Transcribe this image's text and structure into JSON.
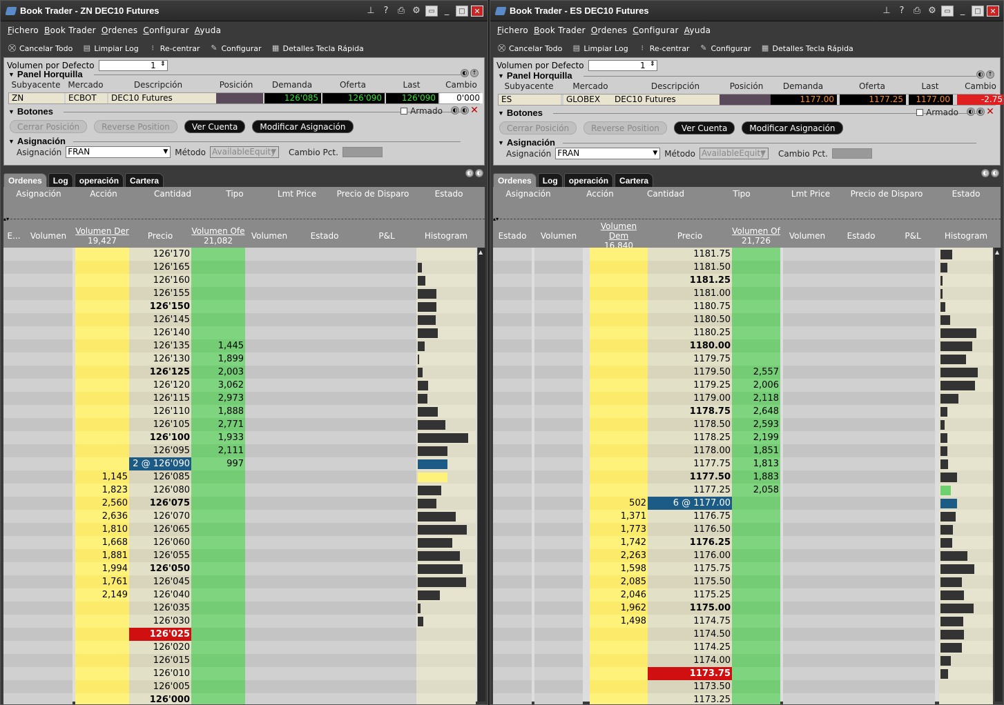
{
  "windows": [
    {
      "title": "Book Trader - ZN DEC10 Futures",
      "menu": [
        "Fichero",
        "Book Trader",
        "Ordenes",
        "Configurar",
        "Ayuda"
      ],
      "toolbar": [
        "Cancelar Todo",
        "Limpiar Log",
        "Re-centrar",
        "Configurar",
        "Detalles Tecla Rápida"
      ],
      "volumen_label": "Volumen por Defecto",
      "volumen_value": "1",
      "panel_title": "Panel Horquilla",
      "headers": [
        "Subyacente",
        "Mercado",
        "Descripción",
        "Posición",
        "Demanda",
        "Oferta",
        "Last",
        "Cambio"
      ],
      "quote": {
        "sub": "ZN",
        "mkt": "ECBOT",
        "desc": "DEC10 Futures",
        "pos": "",
        "bid": "126'085",
        "ask": "126'090",
        "last": "126'090",
        "chg": "0'000",
        "chg_color": "#000000"
      },
      "botones_title": "Botones",
      "armado": "Armado",
      "buttons": [
        "Cerrar Posición",
        "Reverse Position",
        "Ver Cuenta",
        "Modificar Asignación"
      ],
      "asig_title": "Asignación",
      "asig_label": "Asignación",
      "asig_value": "FRAN",
      "metodo_label": "Método",
      "metodo_value": "AvailableEquity",
      "cambio_pct": "Cambio Pct.",
      "tabs": [
        "Ordenes",
        "Log",
        "operación",
        "Cartera"
      ],
      "order_cols": [
        "Asignación",
        "Acción",
        "Cantidad",
        "Tipo",
        "Lmt Price",
        "Precio de Disparo",
        "Estado"
      ],
      "book_cols": {
        "estado": "E...",
        "vol1": "Volumen",
        "bidvol": "Volumen Der",
        "bidvol_total": "19,427",
        "price": "Precio",
        "askvol": "Volumen Ofe",
        "askvol_total": "21,082",
        "vol2": "Volumen",
        "estado2": "Estado",
        "pnl": "P&L",
        "hist": "Histogram"
      },
      "rows": [
        {
          "p": "126'170",
          "b": "",
          "a": "",
          "h": 0,
          "bold": false
        },
        {
          "p": "126'165",
          "b": "",
          "a": "",
          "h": 0.08
        },
        {
          "p": "126'160",
          "b": "",
          "a": "",
          "h": 0.14
        },
        {
          "p": "126'155",
          "b": "",
          "a": "",
          "h": 0.36
        },
        {
          "p": "126'150",
          "b": "",
          "a": "",
          "h": 0.36,
          "bold": true
        },
        {
          "p": "126'145",
          "b": "",
          "a": "",
          "h": 0.34
        },
        {
          "p": "126'140",
          "b": "",
          "a": "",
          "h": 0.38
        },
        {
          "p": "126'135",
          "b": "",
          "a": "1,445",
          "h": 0.13
        },
        {
          "p": "126'130",
          "b": "",
          "a": "1,899",
          "h": 0.03
        },
        {
          "p": "126'125",
          "b": "",
          "a": "2,003",
          "h": 0.09,
          "bold": true
        },
        {
          "p": "126'120",
          "b": "",
          "a": "3,062",
          "h": 0.2
        },
        {
          "p": "126'115",
          "b": "",
          "a": "2,973",
          "h": 0.18
        },
        {
          "p": "126'110",
          "b": "",
          "a": "1,888",
          "h": 0.38
        },
        {
          "p": "126'105",
          "b": "",
          "a": "2,771",
          "h": 0.52
        },
        {
          "p": "126'100",
          "b": "",
          "a": "1,933",
          "h": 0.96,
          "bold": true
        },
        {
          "p": "126'095",
          "b": "",
          "a": "2,111",
          "h": 0.57
        },
        {
          "p": "2 @ 126'090",
          "b": "",
          "a": "997",
          "h": 0.57,
          "hl": "order"
        },
        {
          "p": "126'085",
          "b": "1,145",
          "a": "",
          "h": 0.57,
          "hy": true
        },
        {
          "p": "126'080",
          "b": "1,823",
          "a": "",
          "h": 0.45
        },
        {
          "p": "126'075",
          "b": "2,560",
          "a": "",
          "h": 0.36,
          "bold": true
        },
        {
          "p": "126'070",
          "b": "2,636",
          "a": "",
          "h": 0.72
        },
        {
          "p": "126'065",
          "b": "1,810",
          "a": "",
          "h": 0.94
        },
        {
          "p": "126'060",
          "b": "1,668",
          "a": "",
          "h": 0.66
        },
        {
          "p": "126'055",
          "b": "1,881",
          "a": "",
          "h": 0.8
        },
        {
          "p": "126'050",
          "b": "1,994",
          "a": "",
          "h": 0.86,
          "bold": true
        },
        {
          "p": "126'045",
          "b": "1,761",
          "a": "",
          "h": 0.92
        },
        {
          "p": "126'040",
          "b": "2,149",
          "a": "",
          "h": 0.42
        },
        {
          "p": "126'035",
          "b": "",
          "a": "",
          "h": 0.05
        },
        {
          "p": "126'030",
          "b": "",
          "a": "",
          "h": 0.1
        },
        {
          "p": "126'025",
          "b": "",
          "a": "",
          "h": 0,
          "hl": "red"
        },
        {
          "p": "126'020",
          "b": "",
          "a": "",
          "h": 0
        },
        {
          "p": "126'015",
          "b": "",
          "a": "",
          "h": 0
        },
        {
          "p": "126'010",
          "b": "",
          "a": "",
          "h": 0
        },
        {
          "p": "126'005",
          "b": "",
          "a": "",
          "h": 0
        },
        {
          "p": "126'000",
          "b": "",
          "a": "",
          "h": 0,
          "bold": true
        }
      ]
    },
    {
      "title": "Book Trader - ES DEC10 Futures",
      "menu": [
        "Fichero",
        "Book Trader",
        "Ordenes",
        "Configurar",
        "Ayuda"
      ],
      "toolbar": [
        "Cancelar Todo",
        "Limpiar Log",
        "Re-centrar",
        "Configurar",
        "Detalles Tecla Rápida"
      ],
      "volumen_label": "Volumen por Defecto",
      "volumen_value": "1",
      "panel_title": "Panel Horquilla",
      "headers": [
        "Subyacente",
        "Mercado",
        "Descripción",
        "Posición",
        "Demanda",
        "Oferta",
        "Last",
        "Cambio"
      ],
      "quote": {
        "sub": "ES",
        "mkt": "GLOBEX",
        "desc": "DEC10 Futures",
        "pos": "",
        "bid": "1177.00",
        "ask": "1177.25",
        "last": "1177.00",
        "chg": "-2.75",
        "chg_color": "#ffffff"
      },
      "botones_title": "Botones",
      "armado": "Armado",
      "buttons": [
        "Cerrar Posición",
        "Reverse Position",
        "Ver Cuenta",
        "Modificar Asignación"
      ],
      "asig_title": "Asignación",
      "asig_label": "Asignación",
      "asig_value": "FRAN",
      "metodo_label": "Método",
      "metodo_value": "AvailableEquity",
      "cambio_pct": "Cambio Pct.",
      "tabs": [
        "Ordenes",
        "Log",
        "operación",
        "Cartera"
      ],
      "order_cols": [
        "Asignación",
        "Acción",
        "Cantidad",
        "Tipo",
        "Lmt Price",
        "Precio de Disparo",
        "Estado"
      ],
      "book_cols": {
        "estado": "Estado",
        "vol1": "Volumen",
        "bidvol": "Volumen Dem",
        "bidvol_total": "16,840",
        "price": "Precio",
        "askvol": "Volumen Of",
        "askvol_total": "21,726",
        "vol2": "Volumen",
        "estado2": "Estado",
        "pnl": "P&L",
        "hist": "Histogram"
      },
      "rows": [
        {
          "p": "1181.75",
          "b": "",
          "a": "",
          "h": 0.25
        },
        {
          "p": "1181.50",
          "b": "",
          "a": "",
          "h": 0.15
        },
        {
          "p": "1181.25",
          "b": "",
          "a": "",
          "h": 0.05,
          "bold": true
        },
        {
          "p": "1181.00",
          "b": "",
          "a": "",
          "h": 0.05
        },
        {
          "p": "1180.75",
          "b": "",
          "a": "",
          "h": 0.1
        },
        {
          "p": "1180.50",
          "b": "",
          "a": "",
          "h": 0.2
        },
        {
          "p": "1180.25",
          "b": "",
          "a": "",
          "h": 0.76
        },
        {
          "p": "1180.00",
          "b": "",
          "a": "",
          "h": 0.68,
          "bold": true
        },
        {
          "p": "1179.75",
          "b": "",
          "a": "",
          "h": 0.54
        },
        {
          "p": "1179.50",
          "b": "",
          "a": "2,557",
          "h": 0.8
        },
        {
          "p": "1179.25",
          "b": "",
          "a": "2,006",
          "h": 0.74
        },
        {
          "p": "1179.00",
          "b": "",
          "a": "2,118",
          "h": 0.38
        },
        {
          "p": "1178.75",
          "b": "",
          "a": "2,648",
          "h": 0.14,
          "bold": true
        },
        {
          "p": "1178.50",
          "b": "",
          "a": "2,593",
          "h": 0.09
        },
        {
          "p": "1178.25",
          "b": "",
          "a": "2,199",
          "h": 0.14
        },
        {
          "p": "1178.00",
          "b": "",
          "a": "1,851",
          "h": 0.14
        },
        {
          "p": "1177.75",
          "b": "",
          "a": "1,813",
          "h": 0.16
        },
        {
          "p": "1177.50",
          "b": "",
          "a": "1,883",
          "h": 0.36,
          "bold": true
        },
        {
          "p": "1177.25",
          "b": "",
          "a": "2,058",
          "h": 0.22,
          "hg": true
        },
        {
          "p": "6 @ 1177.00",
          "b": "502",
          "a": "",
          "h": 0.36,
          "hl": "order"
        },
        {
          "p": "1176.75",
          "b": "1,371",
          "a": "",
          "h": 0.32
        },
        {
          "p": "1176.50",
          "b": "1,773",
          "a": "",
          "h": 0.26
        },
        {
          "p": "1176.25",
          "b": "1,742",
          "a": "",
          "h": 0.25,
          "bold": true
        },
        {
          "p": "1176.00",
          "b": "2,263",
          "a": "",
          "h": 0.58
        },
        {
          "p": "1175.75",
          "b": "1,598",
          "a": "",
          "h": 0.72
        },
        {
          "p": "1175.50",
          "b": "2,085",
          "a": "",
          "h": 0.46
        },
        {
          "p": "1175.25",
          "b": "2,046",
          "a": "",
          "h": 0.5
        },
        {
          "p": "1175.00",
          "b": "1,962",
          "a": "",
          "h": 0.7,
          "bold": true
        },
        {
          "p": "1174.75",
          "b": "1,498",
          "a": "",
          "h": 0.48
        },
        {
          "p": "1174.50",
          "b": "",
          "a": "",
          "h": 0.5
        },
        {
          "p": "1174.25",
          "b": "",
          "a": "",
          "h": 0.46
        },
        {
          "p": "1174.00",
          "b": "",
          "a": "",
          "h": 0.22
        },
        {
          "p": "1173.75",
          "b": "",
          "a": "",
          "h": 0.16,
          "hl": "red"
        },
        {
          "p": "1173.50",
          "b": "",
          "a": "",
          "h": 0
        },
        {
          "p": "1173.25",
          "b": "",
          "a": "",
          "h": 0
        }
      ]
    }
  ]
}
